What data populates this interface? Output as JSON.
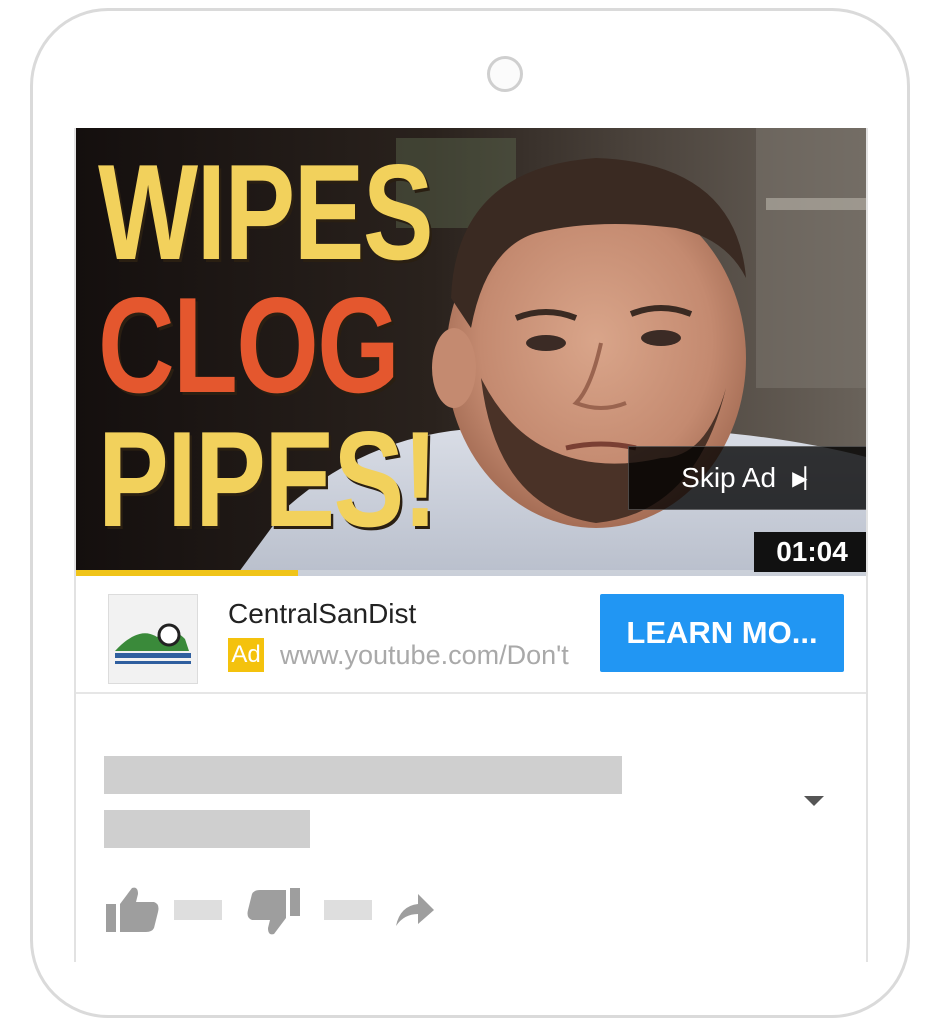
{
  "video": {
    "headline": [
      {
        "text": "WIPES",
        "color": "#f2d15c"
      },
      {
        "text": "CLOG",
        "color": "#e4572e"
      },
      {
        "text": "PIPES!",
        "color": "#f2d15c"
      }
    ],
    "skip_label": "Skip Ad",
    "skip_icon": "skip-next-icon",
    "timer": "01:04",
    "progress_fraction": 0.28,
    "progress_color": "#f0c419"
  },
  "ad": {
    "advertiser": "CentralSanDist",
    "badge": "Ad",
    "url": "www.youtube.com/Don't",
    "cta": "LEARN MO...",
    "cta_color": "#2196f3",
    "badge_color": "#f4c20d"
  },
  "actions": {
    "like_icon": "thumbs-up-icon",
    "dislike_icon": "thumbs-down-icon",
    "share_icon": "share-icon",
    "expand_icon": "chevron-down-icon"
  }
}
